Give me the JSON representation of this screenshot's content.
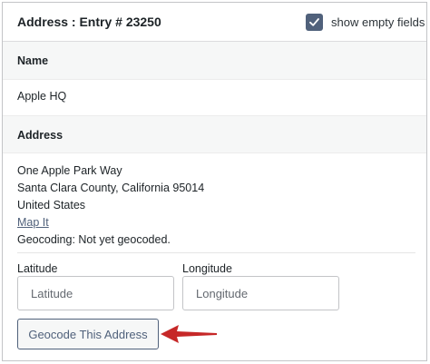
{
  "header": {
    "title": "Address : Entry # 23250",
    "toggle_label": "show empty fields",
    "toggle_checked": true
  },
  "name_section": {
    "label": "Name",
    "value": "Apple HQ"
  },
  "address_section": {
    "label": "Address",
    "lines": [
      "One Apple Park Way",
      "Santa Clara County, California 95014",
      "United States"
    ],
    "map_link": "Map It",
    "geocoding_status": "Geocoding: Not yet geocoded."
  },
  "fields": {
    "latitude": {
      "label": "Latitude",
      "placeholder": "Latitude",
      "value": ""
    },
    "longitude": {
      "label": "Longitude",
      "placeholder": "Longitude",
      "value": ""
    }
  },
  "geocode_button": {
    "label": "Geocode This Address"
  },
  "colors": {
    "accent": "#50617b",
    "arrow": "#c62828",
    "section_bg": "#f6f7f7"
  },
  "icons": {
    "checkbox": "checkmark-icon",
    "pointer": "arrow-left-icon"
  }
}
